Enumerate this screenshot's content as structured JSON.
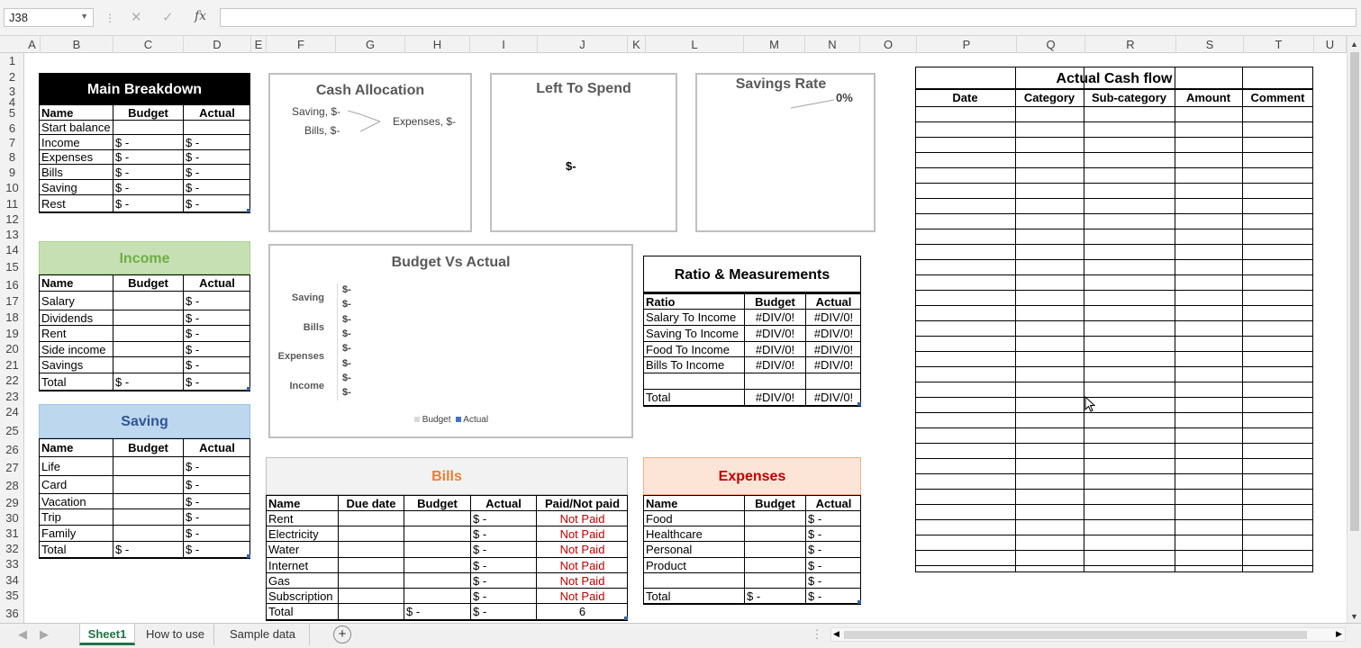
{
  "formula_bar": {
    "name_box": "J38",
    "fx": "fx",
    "cancel": "✕",
    "enter": "✓",
    "formula": ""
  },
  "columns": [
    "A",
    "B",
    "C",
    "D",
    "E",
    "F",
    "G",
    "H",
    "I",
    "J",
    "K",
    "L",
    "M",
    "N",
    "O",
    "P",
    "Q",
    "R",
    "S",
    "T",
    "U"
  ],
  "rows": [
    "1",
    "2",
    "3",
    "4",
    "5",
    "6",
    "7",
    "8",
    "9",
    "10",
    "11",
    "12",
    "13",
    "14",
    "15",
    "16",
    "17",
    "18",
    "19",
    "20",
    "21",
    "22",
    "23",
    "24",
    "25",
    "26",
    "27",
    "28",
    "29",
    "30",
    "31",
    "32",
    "33",
    "34",
    "35",
    "36"
  ],
  "main_breakdown": {
    "title": "Main Breakdown",
    "headers": [
      "Name",
      "Budget",
      "Actual"
    ],
    "rows": [
      [
        "Start balance",
        "",
        ""
      ],
      [
        "Income",
        "$        -",
        "$        -"
      ],
      [
        "Expenses",
        "$        -",
        "$        -"
      ],
      [
        "Bills",
        "$        -",
        "$        -"
      ],
      [
        "Saving",
        "$        -",
        "$        -"
      ],
      [
        "Rest",
        "$        -",
        "$        -"
      ]
    ]
  },
  "income": {
    "title": "Income",
    "headers": [
      "Name",
      "Budget",
      "Actual"
    ],
    "rows": [
      [
        "Salary",
        "",
        "$        -"
      ],
      [
        "Dividends",
        "",
        "$        -"
      ],
      [
        "Rent",
        "",
        "$        -"
      ],
      [
        "Side income",
        "",
        "$        -"
      ],
      [
        "Savings",
        "",
        "$        -"
      ],
      [
        "Total",
        "$        -",
        "$        -"
      ]
    ]
  },
  "saving": {
    "title": "Saving",
    "headers": [
      "Name",
      "Budget",
      "Actual"
    ],
    "rows": [
      [
        "Life",
        "",
        "$        -"
      ],
      [
        "Card",
        "",
        "$        -"
      ],
      [
        "Vacation",
        "",
        "$        -"
      ],
      [
        "Trip",
        "",
        "$        -"
      ],
      [
        "Family",
        "",
        "$        -"
      ],
      [
        "Total",
        "$        -",
        "$        -"
      ]
    ]
  },
  "cash_allocation": {
    "title": "Cash Allocation",
    "labels": [
      "Saving,  $-",
      "Bills,  $-",
      "Expenses,  $-"
    ]
  },
  "left_to_spend": {
    "title": "Left To Spend",
    "value": "$-"
  },
  "savings_rate": {
    "title": "Savings Rate",
    "value": "0%"
  },
  "budget_vs_actual": {
    "title": "Budget Vs Actual",
    "categories": [
      "Saving",
      "Bills",
      "Expenses",
      "Income"
    ],
    "value_labels": [
      "$-",
      "$-",
      "$-",
      "$-",
      "$-",
      "$-",
      "$-",
      "$-"
    ],
    "legend": [
      "Budget",
      "Actual"
    ]
  },
  "chart_data": [
    {
      "type": "pie",
      "title": "Cash Allocation",
      "categories": [
        "Saving",
        "Bills",
        "Expenses"
      ],
      "values": [
        0,
        0,
        0
      ]
    },
    {
      "type": "bar",
      "title": "Budget Vs Actual",
      "categories": [
        "Income",
        "Expenses",
        "Bills",
        "Saving"
      ],
      "series": [
        {
          "name": "Budget",
          "values": [
            0,
            0,
            0,
            0
          ]
        },
        {
          "name": "Actual",
          "values": [
            0,
            0,
            0,
            0
          ]
        }
      ],
      "orientation": "horizontal",
      "legend": "bottom"
    }
  ],
  "ratio": {
    "title": "Ratio & Measurements",
    "headers": [
      "Ratio",
      "Budget",
      "Actual"
    ],
    "rows": [
      [
        "Salary To Income",
        "#DIV/0!",
        "#DIV/0!"
      ],
      [
        "Saving To Income",
        "#DIV/0!",
        "#DIV/0!"
      ],
      [
        "Food To Income",
        "#DIV/0!",
        "#DIV/0!"
      ],
      [
        "Bills To Income",
        "#DIV/0!",
        "#DIV/0!"
      ],
      [
        "",
        "",
        ""
      ],
      [
        "Total",
        "#DIV/0!",
        "#DIV/0!"
      ]
    ]
  },
  "bills": {
    "title": "Bills",
    "headers": [
      "Name",
      "Due date",
      "Budget",
      "Actual",
      "Paid/Not paid"
    ],
    "rows": [
      [
        "Rent",
        "",
        "",
        "$        -",
        "Not Paid"
      ],
      [
        "Electricity",
        "",
        "",
        "$        -",
        "Not Paid"
      ],
      [
        "Water",
        "",
        "",
        "$        -",
        "Not Paid"
      ],
      [
        "Internet",
        "",
        "",
        "$        -",
        "Not Paid"
      ],
      [
        "Gas",
        "",
        "",
        "$        -",
        "Not Paid"
      ],
      [
        "Subscription",
        "",
        "",
        "$        -",
        "Not Paid"
      ],
      [
        "Total",
        "",
        "$        -",
        "$        -",
        "6"
      ]
    ]
  },
  "expenses": {
    "title": "Expenses",
    "headers": [
      "Name",
      "Budget",
      "Actual"
    ],
    "rows": [
      [
        "Food",
        "",
        "$     -"
      ],
      [
        "Healthcare",
        "",
        "$     -"
      ],
      [
        "Personal",
        "",
        "$     -"
      ],
      [
        "Product",
        "",
        "$     -"
      ],
      [
        "",
        "",
        "$     -"
      ],
      [
        "Total",
        "$     -",
        "$     -"
      ]
    ]
  },
  "cashflow": {
    "title": "Actual Cash flow",
    "headers": [
      "Date",
      "Category",
      "Sub-category",
      "Amount",
      "Comment"
    ]
  },
  "tabs": [
    "Sheet1",
    "How to use",
    "Sample data"
  ],
  "colors": {
    "main_header": "#000000",
    "income_fill": "#c6e0b4",
    "income_text": "#70ad47",
    "saving_fill": "#bdd7ee",
    "saving_text": "#2f5597",
    "bills_fill": "#f2f2f2",
    "bills_text": "#ed7d31",
    "expenses_fill": "#fce4d6",
    "expenses_text": "#c00000",
    "not_paid": "#c00000",
    "active_tab": "#217346"
  }
}
